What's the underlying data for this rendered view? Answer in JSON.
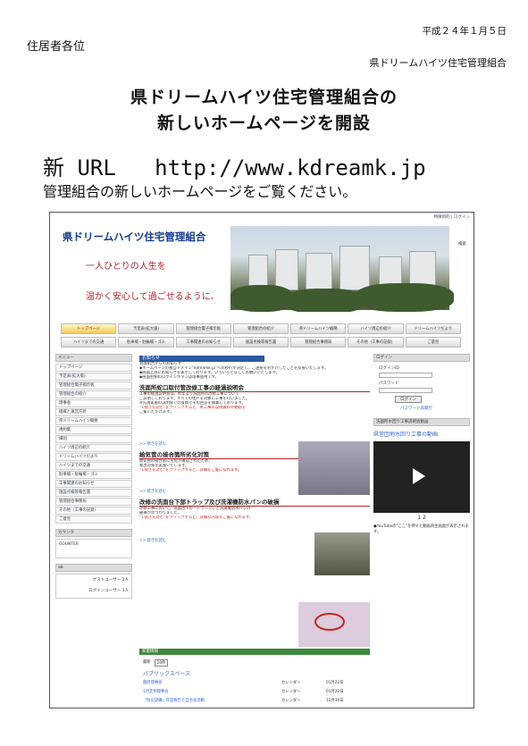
{
  "letter": {
    "date": "平成２４年１月５日",
    "addressee": "住居者各位",
    "sender": "県ドリームハイツ住宅管理組合",
    "title_line1": "県ドリームハイツ住宅管理組合の",
    "title_line2": "新しいホームページを開設",
    "url_prefix": "新",
    "url_label": " URL   http://www.kdreamk.jp",
    "intro": "管理組合の新しいホームページをご覧ください。"
  },
  "site": {
    "utility_links": "特徴目的 | ログイン",
    "name": "県ドリームハイツ住宅管理組合",
    "tagline1": "一人ひとりの人生を",
    "tagline2": "温かく安心して過ごせるように、",
    "flag_label": "検索",
    "nav_row1": [
      "トップページ",
      "予定表(拡大版)",
      "管理組合電子掲示板",
      "管理組合の紹介",
      "県ドリームハイツ概略",
      "ハイツ周辺の紹介",
      "ドリームハイツだより"
    ],
    "nav_row2": [
      "ハイツまでの交通",
      "駐車場・駐輪場・ゴミ",
      "工事関連のお知らせ",
      "施設点検等報告書",
      "管理組合事務局",
      "その他（工事の記録）",
      "ご意見"
    ],
    "sidebar_menu_title": "メニュー",
    "sidebar_items": [
      "トップページ",
      "予定表(拡大版)",
      "管理組合電子掲示板",
      "管理組合の紹介",
      "理事会",
      "組織と運営方針",
      "県ドリームハイツ概要",
      "規約集",
      "細則",
      "ハイツ周辺の紹介",
      "ドリームハイツだより",
      "ハイツまでの交通",
      "駐車場・駐輪場・ゴミ",
      "工事関連のお知らせ",
      "施設点検等報告書",
      "管理組合事務局",
      "その他（工事の記録）",
      "ご意見"
    ],
    "counter_title": "カウンタ",
    "counter_label": "COUNTER",
    "online_title": "ab",
    "online_rows": [
      "ゲストユーザー 2人",
      "ログインユーザー 1人"
    ],
    "notice_bar": "お知らせ",
    "notice_lines": [
      "管理組合からのお知らせ",
      "◆ホームページの独自ドメイン\"kdreamk.jp\"への移行が決定し、ご迷惑をおかけしたことを反省いたします。",
      "◆画面上部にお知らせを表示しております。いろいろと宜しくお願いいたします。",
      "◆画面右側のログインボタンは理事会用です。"
    ],
    "article1_title": "洗面所蛇口取付管改修工事の経過説明会",
    "article1_lines": [
      "工事の経過説明会は、昨年より洗面所の改修工事について",
      "ご説明しております。すべての住戸を対象に工事を行いました。",
      "※先週実施の説明会での質問とその回答を掲載しております。",
      "\"↓続きを読む\"をクリックすると、本工事の説明資料や動画を",
      "ご覧いただけます。"
    ],
    "article2_title": "給気管の接合箇所劣化対策",
    "article2_lines": [
      "給気管の接合部に劣化が確認されたため、",
      "緊急対策を実施いたします。",
      "\"↓続きを読む\"をクリックすると、詳細をご覧になれます。"
    ],
    "article3_title": "改修の洗面台下部トラップ及び洗濯機防水パンの破損",
    "article3_lines": [
      "改修工事において、洗面台下の「トラップ」と洗濯機防水パンの",
      "破損が見つかりました。",
      "\"↓続きを読む\"をクリックすると、詳細な内容をご覧になれます。"
    ],
    "read_more": ">> 続きを読む",
    "login_title": "ログイン",
    "login_id": "ログインID",
    "login_pw": "パスワード",
    "login_btn": "ログイン",
    "login_reissue": "パスワード再発行",
    "video_panel_title": "洗面所水回り工事説明会動画",
    "video_title": "県営団地水回り工事の動画",
    "video_pager": "1   2",
    "video_notes": "●YouTubeの\"ここ\"を押すと動画再生画面が表示されます。",
    "footer_bar": "新着情報",
    "footer_select_label": "最新",
    "footer_select_value": "20件",
    "footer_heading": "パブリックスペース",
    "footer_rows": [
      {
        "title": "臨時理事会",
        "kind": "カレンダー",
        "date": "01月22日"
      },
      {
        "title": "1月定例理事会",
        "kind": "カレンダー",
        "date": "01月22日"
      },
      {
        "title": "「防災訓練」年度報告と自治会活動",
        "kind": "カレンダー",
        "date": "12月30日"
      }
    ]
  }
}
